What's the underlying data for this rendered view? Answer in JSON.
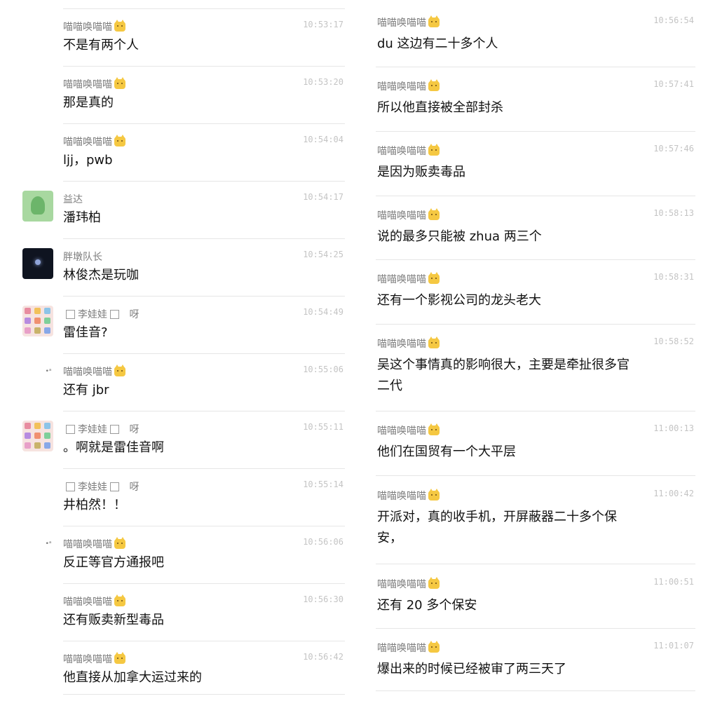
{
  "left_messages": [
    {
      "sender": "喵喵唤喵喵",
      "badge": "cat-icon",
      "time": "10:53:17",
      "lines": [
        "不是有两个人"
      ]
    },
    {
      "sender": "喵喵唤喵喵",
      "badge": "cat-icon",
      "time": "10:53:20",
      "lines": [
        "那是真的"
      ]
    },
    {
      "sender": "喵喵唤喵喵",
      "badge": "cat-icon",
      "time": "10:54:04",
      "lines": [
        "ljj，pwb"
      ]
    },
    {
      "sender": "益达",
      "time": "10:54:17",
      "lines": [
        "潘玮柏"
      ],
      "avatar": "green-dino-avatar"
    },
    {
      "sender": "胖墩队长",
      "time": "10:54:25",
      "lines": [
        "林俊杰是玩咖"
      ],
      "avatar": "night-sky-avatar"
    },
    {
      "sender_prefix": "",
      "sender": "李娃娃",
      "sender_suffix": "呀",
      "boxed": true,
      "time": "10:54:49",
      "lines": [
        "雷佳音?"
      ],
      "avatar": "sticker-avatar"
    },
    {
      "sender": "喵喵唤喵喵",
      "badge": "cat-icon",
      "time": "10:55:06",
      "lines": [
        "还有 jbr"
      ],
      "avatar": "small-avatar"
    },
    {
      "sender": "李娃娃",
      "sender_suffix": "呀",
      "boxed": true,
      "time": "10:55:11",
      "lines": [
        "。啊就是雷佳音啊"
      ],
      "avatar": "sticker-avatar"
    },
    {
      "sender": "李娃娃",
      "sender_suffix": "呀",
      "boxed": true,
      "time": "10:55:14",
      "lines": [
        "井柏然！！"
      ]
    },
    {
      "sender": "喵喵唤喵喵",
      "badge": "cat-icon",
      "time": "10:56:06",
      "lines": [
        "反正等官方通报吧"
      ],
      "avatar": "small-avatar"
    },
    {
      "sender": "喵喵唤喵喵",
      "badge": "cat-icon",
      "time": "10:56:30",
      "lines": [
        "还有贩卖新型毒品"
      ]
    },
    {
      "sender": "喵喵唤喵喵",
      "badge": "cat-icon",
      "time": "10:56:42",
      "lines": [
        "他直接从加拿大运过来的"
      ]
    }
  ],
  "right_messages": [
    {
      "sender": "喵喵唤喵喵",
      "badge": "cat-icon",
      "time": "10:56:54",
      "lines": [
        "du 这边有二十多个人"
      ]
    },
    {
      "sender": "喵喵唤喵喵",
      "badge": "cat-icon",
      "time": "10:57:41",
      "lines": [
        "所以他直接被全部封杀"
      ]
    },
    {
      "sender": "喵喵唤喵喵",
      "badge": "cat-icon",
      "time": "10:57:46",
      "lines": [
        "是因为贩卖毒品"
      ]
    },
    {
      "sender": "喵喵唤喵喵",
      "badge": "cat-icon",
      "time": "10:58:13",
      "lines": [
        "说的最多只能被 zhua 两三个"
      ]
    },
    {
      "sender": "喵喵唤喵喵",
      "badge": "cat-icon",
      "time": "10:58:31",
      "lines": [
        "还有一个影视公司的龙头老大"
      ]
    },
    {
      "sender": "喵喵唤喵喵",
      "badge": "cat-icon",
      "time": "10:58:52",
      "lines": [
        "吴这个事情真的影响很大，主要是牵扯很多官",
        "二代"
      ]
    },
    {
      "sender": "喵喵唤喵喵",
      "badge": "cat-icon",
      "time": "11:00:13",
      "lines": [
        "他们在国贸有一个大平层"
      ]
    },
    {
      "sender": "喵喵唤喵喵",
      "badge": "cat-icon",
      "time": "11:00:42",
      "lines": [
        "开派对，真的收手机，开屏蔽器二十多个保",
        "安，"
      ]
    },
    {
      "sender": "喵喵唤喵喵",
      "badge": "cat-icon",
      "time": "11:00:51",
      "lines": [
        "还有 20 多个保安"
      ]
    },
    {
      "sender": "喵喵唤喵喵",
      "badge": "cat-icon",
      "time": "11:01:07",
      "lines": [
        "爆出来的时候已经被审了两三天了"
      ]
    }
  ]
}
